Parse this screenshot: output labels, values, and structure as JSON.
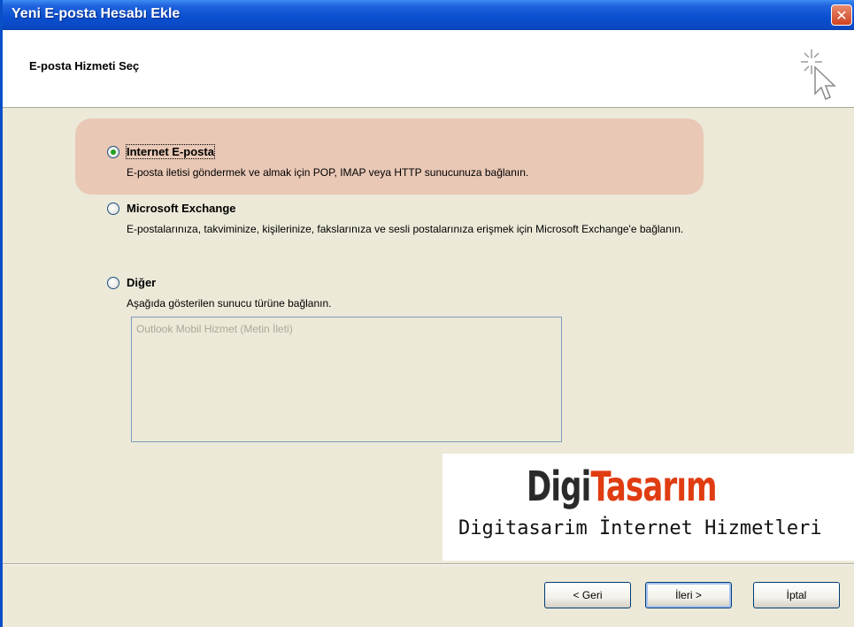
{
  "window": {
    "title": "Yeni E-posta Hesabı Ekle",
    "close_symbol": "✕"
  },
  "header": {
    "title": "E-posta Hizmeti Seç",
    "icon": "wizard-cursor-sparkle-icon"
  },
  "options": [
    {
      "label": "Internet E-posta",
      "description": "E-posta iletisi göndermek ve almak için POP, IMAP veya HTTP sunucunuza bağlanın.",
      "selected": true
    },
    {
      "label": "Microsoft Exchange",
      "description": "E-postalarınıza, takviminize, kişilerinize, fakslarınıza ve sesli postalarınıza erişmek için Microsoft Exchange'e bağlanın.",
      "selected": false
    },
    {
      "label": "Diğer",
      "description": "Aşağıda gösterilen sunucu türüne bağlanın.",
      "selected": false
    }
  ],
  "server_list": {
    "items": [
      "Outlook Mobil Hizmet (Metin İleti)"
    ]
  },
  "watermark": {
    "logo_part1": "Digi",
    "logo_part2": "Tasarım",
    "tagline": "Digitasarim İnternet Hizmetleri",
    "colors": {
      "part1": "#2a2a2a",
      "part2": "#e03c12"
    }
  },
  "buttons": {
    "back": "< Geri",
    "next": "İleri >",
    "cancel": "İptal"
  },
  "colors": {
    "titlebar": "#0a4fd0",
    "highlight": "#e9c6b4",
    "dialog_bg": "#ece9d8"
  }
}
